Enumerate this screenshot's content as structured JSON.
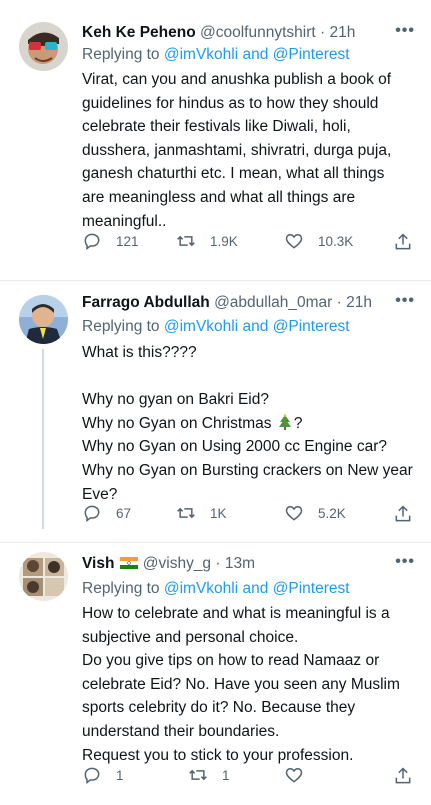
{
  "tweets": [
    {
      "display_name": "Keh Ke Peheno",
      "handle_time": "@coolfunnytshirt · 21h",
      "reply_prefix": "Replying to",
      "reply_targets": "@imVkohli and @Pinterest",
      "lines": [
        "Virat, can you and anushka publish a book of",
        "guidelines for hindus as to how they should",
        "celebrate their festivals like Diwali, holi,",
        "dusshera, janmashtami, shivratri, durga puja,",
        "ganesh chaturthi etc. I mean, what all things",
        "are meaningless and what all things are",
        "meaningful.."
      ],
      "replies": "121",
      "retweets": "1.9K",
      "likes": "10.3K"
    },
    {
      "display_name": "Farrago Abdullah",
      "handle_time": "@abdullah_0mar · 21h",
      "reply_prefix": "Replying to",
      "reply_targets": "@imVkohli and @Pinterest",
      "line1": "What is this????",
      "line2": "Why no gyan on Bakri Eid?",
      "line3a": "Why no Gyan on Christmas",
      "line3b": "?",
      "line4": "Why no Gyan on Using 2000 cc Engine car?",
      "line5": "Why no Gyan on Bursting crackers on New year",
      "line6": "Eve?",
      "replies": "67",
      "retweets": "1K",
      "likes": "5.2K"
    },
    {
      "display_name": "Vish",
      "handle_time": "@vishy_g · 13m",
      "reply_prefix": "Replying to",
      "reply_targets": "@imVkohli and @Pinterest",
      "lines": [
        "How to celebrate and what is meaningful is a",
        "subjective and personal choice.",
        "Do you give tips on how to read Namaaz or",
        "celebrate Eid? No. Have you seen any Muslim",
        "sports celebrity do it? No. Because they",
        "understand their boundaries.",
        "Request you to stick to your profession."
      ],
      "replies": "1",
      "retweets": "1",
      "likes": ""
    }
  ],
  "more_label": "•••",
  "icons": [
    "more-icon",
    "reply-icon",
    "retweet-icon",
    "like-icon",
    "share-icon",
    "christmas-tree-emoji",
    "india-flag-emoji"
  ],
  "colors": {
    "link": "#1d9bf0",
    "muted": "#536471",
    "text": "#0f1419",
    "divider": "#e6ecf0"
  }
}
